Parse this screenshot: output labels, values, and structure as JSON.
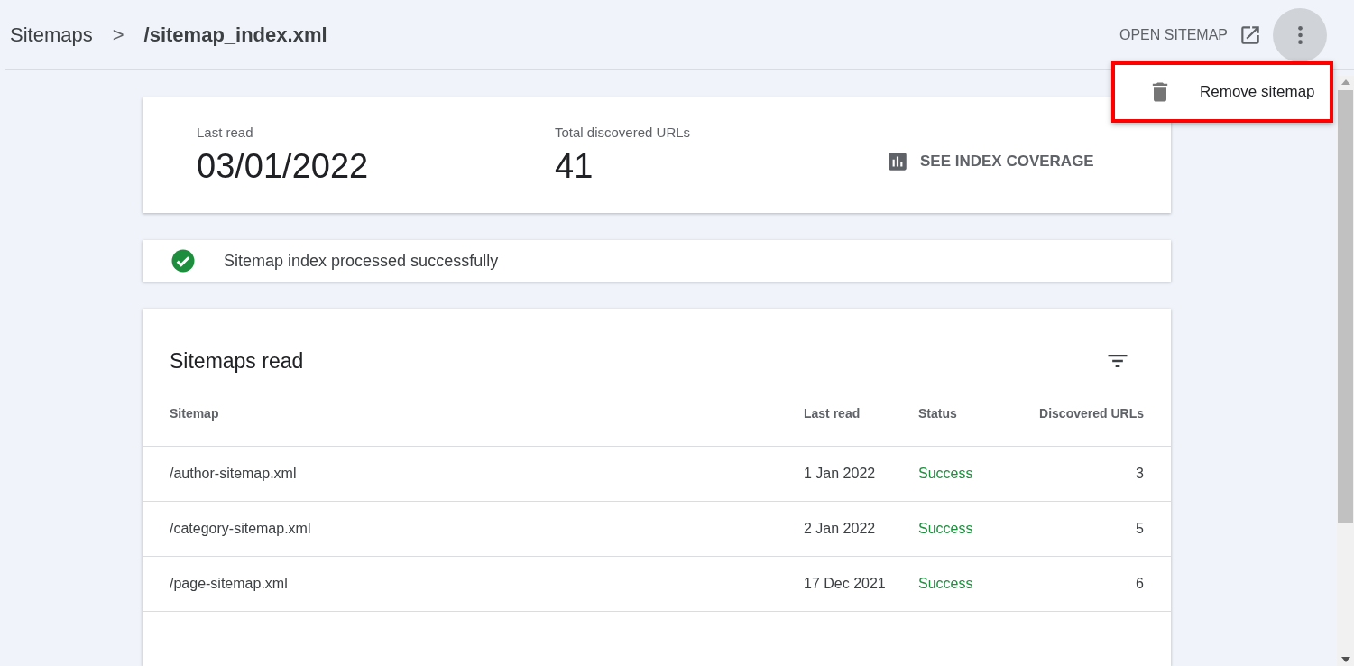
{
  "breadcrumb": {
    "parent": "Sitemaps",
    "separator": ">",
    "current": "/sitemap_index.xml"
  },
  "actions": {
    "open_sitemap": "OPEN SITEMAP"
  },
  "menu": {
    "open": true,
    "highlighted": true,
    "items": [
      {
        "label": "Remove sitemap"
      }
    ]
  },
  "summary": {
    "last_read_label": "Last read",
    "last_read": "03/01/2022",
    "total_label": "Total discovered URLs",
    "total": "41",
    "coverage_link": "SEE INDEX COVERAGE"
  },
  "status_message": "Sitemap index processed successfully",
  "table": {
    "title": "Sitemaps read",
    "columns": [
      "Sitemap",
      "Last read",
      "Status",
      "Discovered URLs"
    ],
    "rows": [
      {
        "sitemap": "/author-sitemap.xml",
        "last_read": "1 Jan 2022",
        "status": "Success",
        "color": "#1e8e3e",
        "discovered_urls": "3"
      },
      {
        "sitemap": "/category-sitemap.xml",
        "last_read": "2 Jan 2022",
        "status": "Success",
        "color": "#1e8e3e",
        "discovered_urls": "5"
      },
      {
        "sitemap": "/page-sitemap.xml",
        "last_read": "17 Dec 2021",
        "status": "Success",
        "color": "#1e8e3e",
        "discovered_urls": "6"
      }
    ]
  }
}
